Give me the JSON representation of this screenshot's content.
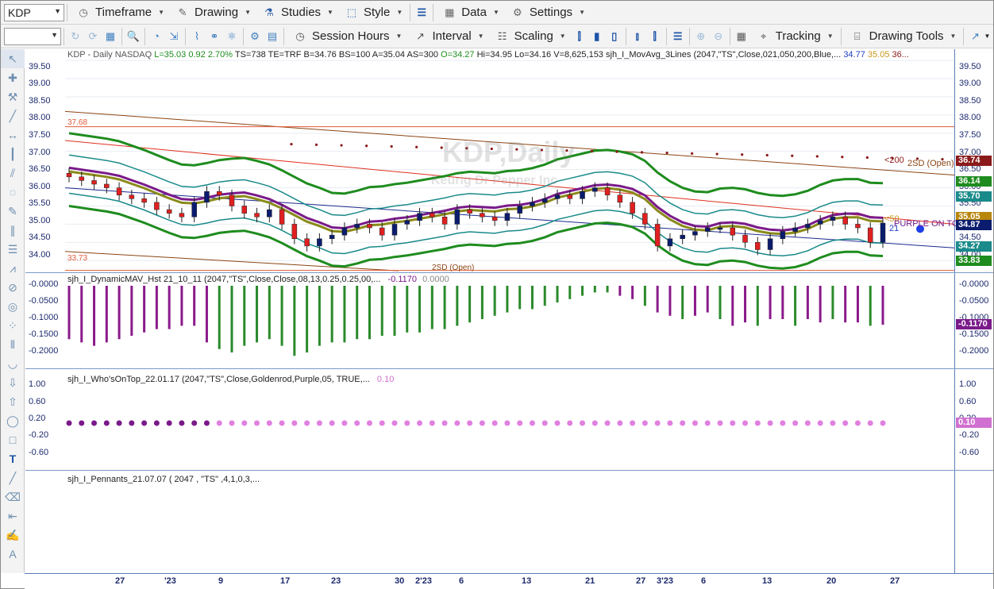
{
  "toolbar1": {
    "symbol": "KDP",
    "timeframe": "Timeframe",
    "drawing": "Drawing",
    "studies": "Studies",
    "style": "Style",
    "data": "Data",
    "settings": "Settings"
  },
  "toolbar2": {
    "session_hours": "Session Hours",
    "interval": "Interval",
    "scaling": "Scaling",
    "tracking": "Tracking",
    "drawing_tools": "Drawing Tools"
  },
  "chart": {
    "watermark_title": "KDP,Daily",
    "watermark_sub": "Keurig Dr Pepper Inc",
    "header": {
      "symbol_info": "KDP - Daily  NASDAQ",
      "last": "L=35.03",
      "change": "0.92",
      "pct": "2.70%",
      "rest": "TS=738  TE=TRF  B=34.76  BS=100  A=35.04  AS=300",
      "open": "O=34.27",
      "hilo": "Hi=34.95  Lo=34.16  V=8,625,153",
      "study": "sjh_I_MovAvg_3Lines (2047,\"TS\",Close,021,050,200,Blue,...",
      "v1": "34.77",
      "v2": "35.05",
      "v3": "36..."
    },
    "price_ticks": [
      "39.50",
      "39.00",
      "38.50",
      "38.00",
      "37.50",
      "37.00",
      "36.50",
      "36.00",
      "35.50",
      "35.00",
      "34.50",
      "34.00"
    ],
    "left_hi": "37.68",
    "left_lo": "33.73",
    "label_200": "<200",
    "label_2sd_top": "2SD (Open)",
    "label_2sd_bottom": "2SD (Open)",
    "label_50": "<50",
    "label_21": "21",
    "label_purple": "PURPLE ON TOP",
    "badges": [
      {
        "text": "36.74",
        "color": "#8b1a1a"
      },
      {
        "text": "36.14",
        "color": "#1e8c1e"
      },
      {
        "text": "35.70",
        "color": "#1a8a8a"
      },
      {
        "text": "35.05",
        "color": "#b8860b"
      },
      {
        "text": "34.87",
        "color": "#0b1c6e"
      },
      {
        "text": "34.27",
        "color": "#1a8a8a"
      },
      {
        "text": "33.83",
        "color": "#1e8c1e"
      }
    ]
  },
  "pane2": {
    "header": "sjh_I_DynamicMAV_Hst 21_10_11 (2047,\"TS\",Close,Close,08,13,0.25,0.25,00,...",
    "v1": "-0.1170",
    "v2": "0.0000",
    "ticks": [
      "-0.0000",
      "-0.0500",
      "-0.1000",
      "-0.1500",
      "-0.2000"
    ],
    "badge": "-0.1170"
  },
  "pane3": {
    "header": "sjh_I_Who'sOnTop_22.01.17 (2047,\"TS\",Close,Goldenrod,Purple,05, TRUE,...",
    "v1": "0.10",
    "ticks": [
      "1.00",
      "0.60",
      "0.20",
      "-0.20",
      "-0.60"
    ],
    "rticks": [
      "1.00",
      "0.60",
      "0.20",
      "-0.20",
      "-0.60"
    ],
    "badge": "0.10"
  },
  "pane4": {
    "header": "sjh_I_Pennants_21.07.07 ( 2047 , \"TS\" ,4,1,0,3,..."
  },
  "xaxis": [
    "27",
    "'23",
    "9",
    "17",
    "23",
    "30",
    "2'23",
    "6",
    "13",
    "21",
    "27",
    "3'23",
    "6",
    "13",
    "20",
    "27"
  ],
  "chart_data": {
    "type": "candlestick",
    "title": "KDP - Daily",
    "categories": [
      "27",
      "'23",
      "9",
      "17",
      "23",
      "30",
      "2'23",
      "6",
      "13",
      "21",
      "27",
      "3'23",
      "6",
      "13",
      "20",
      "27"
    ],
    "close": [
      36.3,
      36.2,
      36.1,
      36.0,
      35.8,
      35.7,
      35.6,
      35.4,
      35.3,
      35.2,
      35.6,
      35.9,
      35.8,
      35.5,
      35.3,
      35.2,
      35.4,
      35.0,
      34.6,
      34.4,
      34.6,
      34.7,
      34.9,
      35.0,
      34.9,
      34.7,
      35.0,
      35.1,
      35.3,
      35.2,
      35.0,
      35.4,
      35.3,
      35.2,
      35.1,
      35.3,
      35.5,
      35.6,
      35.7,
      35.8,
      35.7,
      35.9,
      36.0,
      35.8,
      35.6,
      35.3,
      35.0,
      34.4,
      34.6,
      34.7,
      34.8,
      34.9,
      34.9,
      34.7,
      34.5,
      34.3,
      34.6,
      34.8,
      34.9,
      35.0,
      35.1,
      35.2,
      35.0,
      34.9,
      34.5,
      35.03
    ],
    "ma21": [
      36.8,
      35.0
    ],
    "ma50": [
      37.3,
      35.05
    ],
    "histogram": [
      -0.16,
      -0.17,
      -0.18,
      -0.17,
      -0.16,
      -0.15,
      -0.14,
      -0.13,
      -0.13,
      -0.12,
      -0.12,
      -0.17,
      -0.19,
      -0.2,
      -0.18,
      -0.17,
      -0.16,
      -0.18,
      -0.21,
      -0.2,
      -0.18,
      -0.17,
      -0.17,
      -0.16,
      -0.16,
      -0.15,
      -0.15,
      -0.14,
      -0.14,
      -0.13,
      -0.13,
      -0.12,
      -0.11,
      -0.1,
      -0.09,
      -0.08,
      -0.07,
      -0.07,
      -0.06,
      -0.05,
      -0.04,
      -0.03,
      -0.02,
      -0.02,
      -0.03,
      -0.04,
      -0.06,
      -0.08,
      -0.09,
      -0.1,
      -0.09,
      -0.08,
      -0.1,
      -0.12,
      -0.11,
      -0.12,
      -0.1,
      -0.1,
      -0.12,
      -0.1,
      -0.11,
      -0.1,
      -0.11,
      -0.11,
      -0.12,
      -0.117
    ],
    "ylim": [
      33.7,
      39.7
    ],
    "series": [
      {
        "name": "L=35.03"
      }
    ]
  }
}
